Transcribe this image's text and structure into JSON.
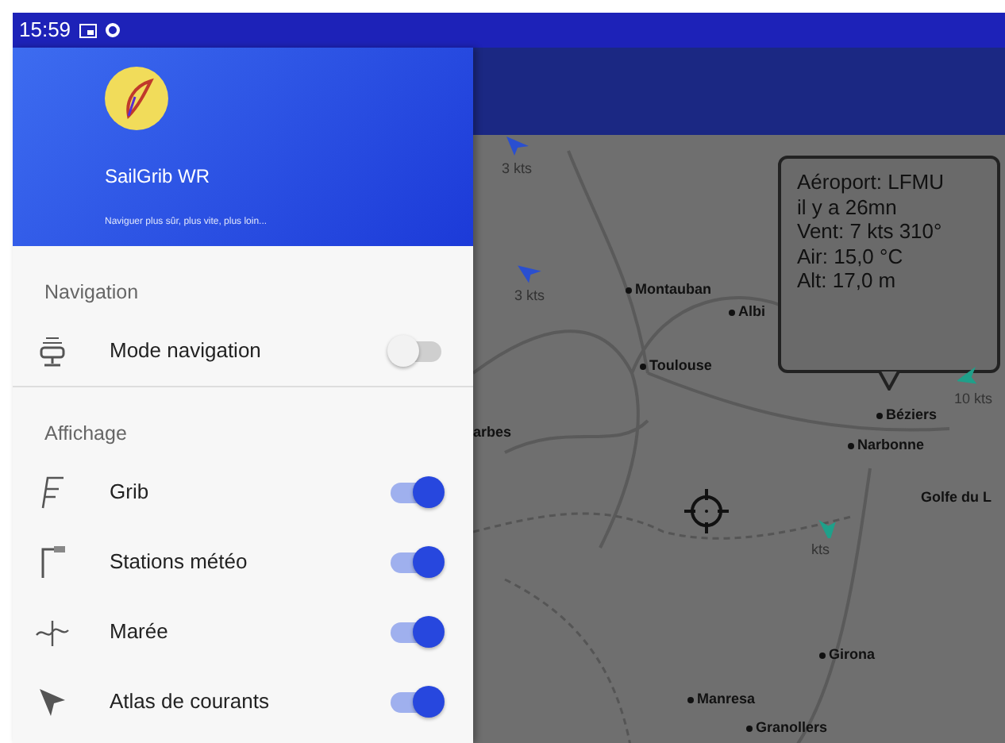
{
  "status_bar": {
    "time": "15:59"
  },
  "drawer": {
    "header": {
      "title": "SailGrib WR",
      "subtitle": "Naviguer plus sûr, plus vite, plus loin..."
    },
    "sections": [
      {
        "title": "Navigation",
        "items": [
          {
            "label": "Mode navigation",
            "kind": "antenna",
            "on": false
          }
        ]
      },
      {
        "title": "Affichage",
        "items": [
          {
            "label": "Grib",
            "kind": "flag",
            "on": true
          },
          {
            "label": "Stations météo",
            "kind": "station",
            "on": true
          },
          {
            "label": "Marée",
            "kind": "tide",
            "on": true
          },
          {
            "label": "Atlas de courants",
            "kind": "cursor",
            "on": true
          }
        ]
      }
    ]
  },
  "map": {
    "wind_markers": [
      {
        "label": "3 kts",
        "color": "#2a4fd0"
      },
      {
        "label": "3 kts",
        "color": "#2a4fd0"
      },
      {
        "label": "10 kts",
        "color": "#1fa08a"
      },
      {
        "label": "kts",
        "color": "#1fa08a"
      }
    ],
    "places": [
      "Montauban",
      "Albi",
      "Toulouse",
      "arbes",
      "Béziers",
      "Narbonne",
      "Golfe du L",
      "Girona",
      "Manresa",
      "Granollers"
    ],
    "callout": {
      "lines": [
        "Aéroport: LFMU",
        "il y a 26mn",
        "Vent:  7 kts 310°",
        "Air: 15,0 °C",
        "Alt: 17,0 m"
      ]
    }
  }
}
